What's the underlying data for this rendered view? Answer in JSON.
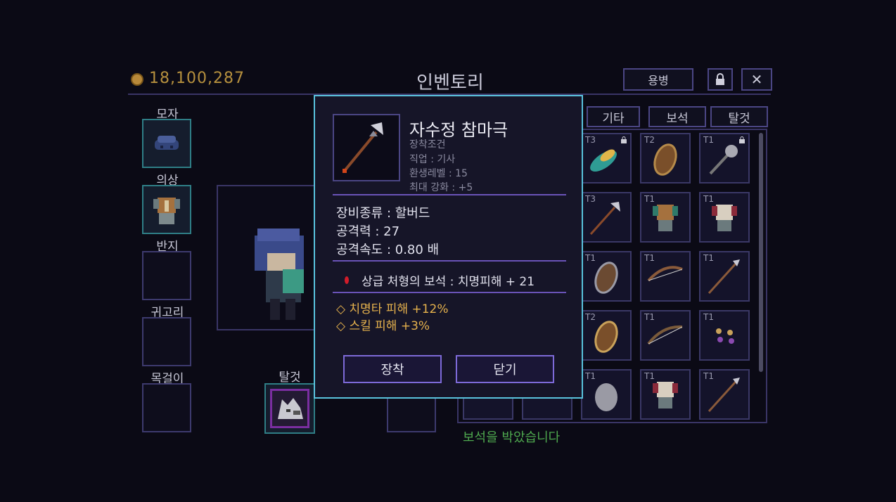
{
  "header": {
    "gold": "18,100,287",
    "title": "인벤토리",
    "mercenary_button": "용병",
    "close_symbol": "✕"
  },
  "equipment": {
    "hat_label": "모자",
    "clothes_label": "의상",
    "ring_label": "반지",
    "earring_label": "귀고리",
    "necklace_label": "목걸이",
    "mount_label": "탈것"
  },
  "tabs": [
    "기타",
    "보석",
    "탈것"
  ],
  "inventory": {
    "tiers": [
      "T3",
      "T2",
      "T1",
      "T3",
      "T1",
      "T1",
      "T1",
      "T1",
      "T1",
      "T2",
      "T1",
      "T1",
      "T1",
      "T1",
      "T1"
    ]
  },
  "status_message": "보석을 박았습니다",
  "dialog": {
    "item_name": "자수정 참마극",
    "requirement_title": "장착조건",
    "req_class": "직업 : 기사",
    "req_rebirth": "환생레벨 : 15",
    "max_enhance": "최대 강화 : +5",
    "equip_type": "장비종류 : 할버드",
    "attack": "공격력 : 27",
    "attack_speed": "공격속도 : 0.80 배",
    "gem": "상급 처형의 보석 : 치명피해 + 21",
    "option1": "◇ 치명타 피해 +12%",
    "option2": "◇ 스킬 피해 +3%",
    "equip_button": "장착",
    "close_button": "닫기"
  },
  "colors": {
    "background": "#0b0a15",
    "dialog_border": "#59c3dd",
    "gold": "#b6903e",
    "option_text": "#e6b24d",
    "status_text": "#4ea84e"
  }
}
